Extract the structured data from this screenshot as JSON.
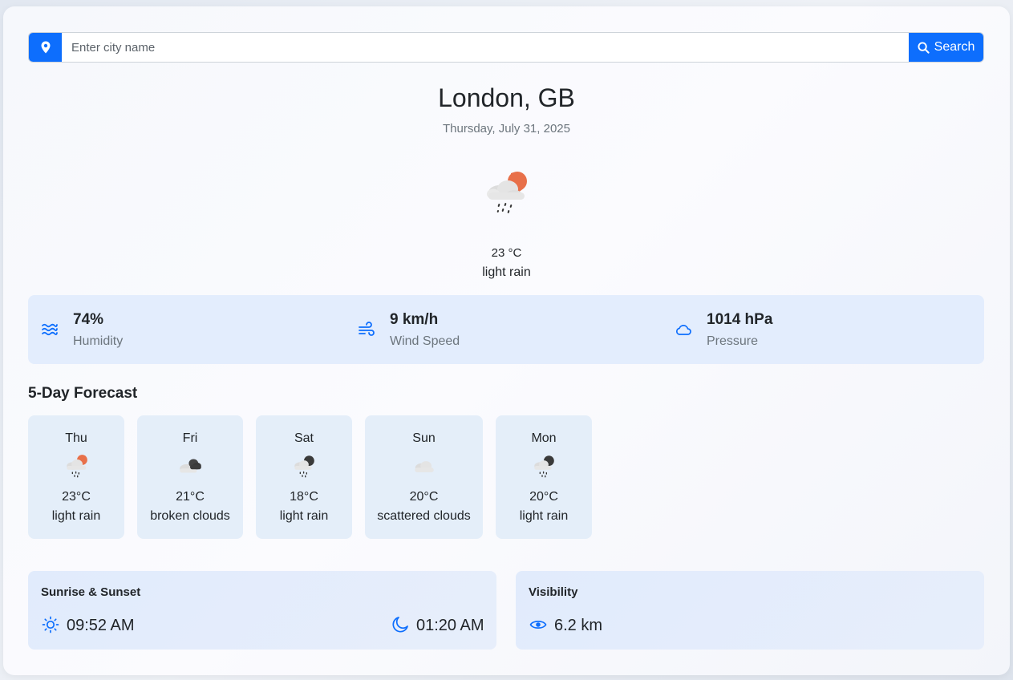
{
  "search": {
    "placeholder": "Enter city name",
    "button_label": "Search",
    "pin_icon": "map-pin-icon",
    "search_icon": "search-icon"
  },
  "current": {
    "city": "London, GB",
    "date": "Thursday, July 31, 2025",
    "temperature": "23 °C",
    "description": "light rain",
    "icon": "rain-sun-icon"
  },
  "stats": [
    {
      "value": "74%",
      "label": "Humidity",
      "icon": "water-waves-icon"
    },
    {
      "value": "9 km/h",
      "label": "Wind Speed",
      "icon": "wind-icon"
    },
    {
      "value": "1014 hPa",
      "label": "Pressure",
      "icon": "cloud-icon"
    }
  ],
  "forecast": {
    "title": "5-Day Forecast",
    "days": [
      {
        "day": "Thu",
        "temp": "23°C",
        "desc": "light rain",
        "icon": "rain-sun-icon"
      },
      {
        "day": "Fri",
        "temp": "21°C",
        "desc": "broken clouds",
        "icon": "broken-clouds-icon"
      },
      {
        "day": "Sat",
        "temp": "18°C",
        "desc": "light rain",
        "icon": "rain-night-icon"
      },
      {
        "day": "Sun",
        "temp": "20°C",
        "desc": "scattered clouds",
        "icon": "scattered-clouds-icon"
      },
      {
        "day": "Mon",
        "temp": "20°C",
        "desc": "light rain",
        "icon": "rain-night-icon"
      }
    ]
  },
  "sun": {
    "title": "Sunrise & Sunset",
    "sunrise": "09:52 AM",
    "sunset": "01:20 AM"
  },
  "visibility": {
    "title": "Visibility",
    "value": "6.2 km"
  },
  "colors": {
    "accent": "#0d6efd",
    "sun_orange": "#e8704a",
    "stats_bg": "#e3edfd",
    "forecast_bg": "#e4eef9"
  }
}
